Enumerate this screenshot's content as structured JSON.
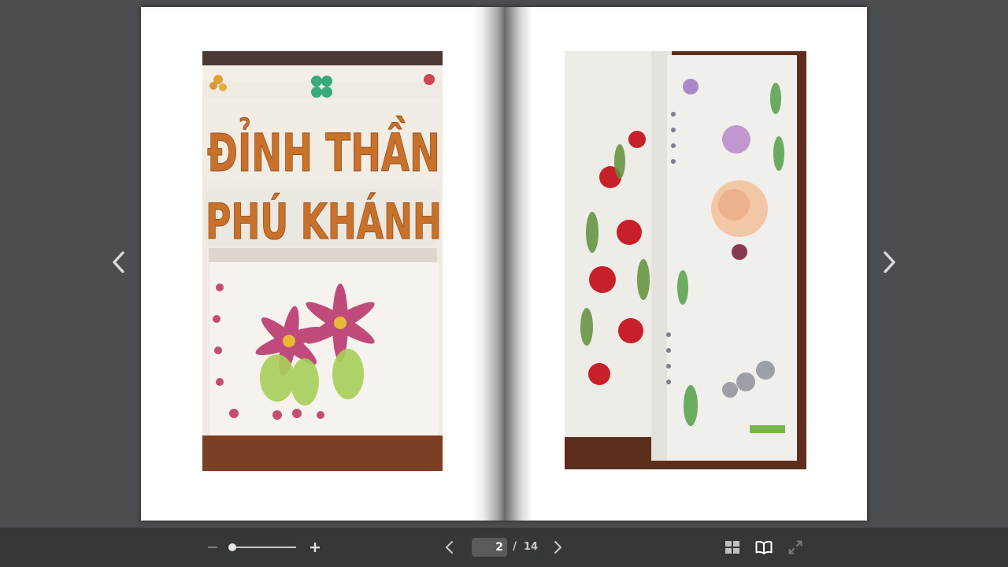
{
  "viewer": {
    "current_page": "2",
    "page_separator": "/",
    "total_pages": "14",
    "zoom_level": 0.0
  },
  "spread": {
    "left_page": {
      "image_text_line1": "ĐỈNH THẦN",
      "image_text_line2": "PHÚ KHÁNH"
    }
  },
  "colors": {
    "background": "#4a4e51",
    "toolbar": "#353839",
    "page": "#ffffff",
    "icon": "#d9d9d9",
    "icon_active": "#ffffff",
    "icon_disabled": "#7a7d80"
  },
  "icons": {
    "prev_page": "chevron-left-icon",
    "next_page": "chevron-right-icon",
    "zoom_out": "minus-icon",
    "zoom_in": "plus-icon",
    "thumbnails": "grid-icon",
    "book_view": "open-book-icon",
    "fullscreen": "expand-icon"
  }
}
